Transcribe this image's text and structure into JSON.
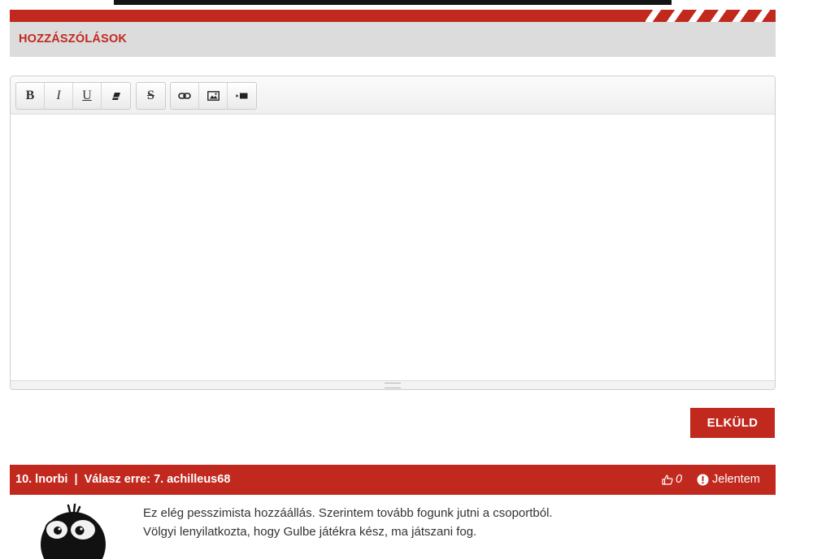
{
  "comments_section": {
    "title": "HOZZÁSZÓLÁSOK"
  },
  "editor": {
    "toolbar": {
      "groups": [
        [
          {
            "name": "bold",
            "icon": "bold-icon",
            "glyph": "B"
          },
          {
            "name": "italic",
            "icon": "italic-icon",
            "glyph": "I"
          },
          {
            "name": "underline",
            "icon": "underline-icon",
            "glyph": "U"
          },
          {
            "name": "remove-format",
            "icon": "eraser-icon"
          }
        ],
        [
          {
            "name": "strikethrough",
            "icon": "strikethrough-icon",
            "glyph": "S"
          }
        ],
        [
          {
            "name": "link",
            "icon": "link-icon"
          },
          {
            "name": "image",
            "icon": "image-icon"
          },
          {
            "name": "video",
            "icon": "video-icon"
          }
        ]
      ]
    },
    "content": ""
  },
  "submit": {
    "label": "ELKÜLD"
  },
  "comment": {
    "header": "10. lnorbi  |  Válasz erre: 7. achilleus68",
    "likes": "0",
    "report_label": "Jelentem",
    "lines": [
      "Ez elég pesszimista hozzáállás. Szerintem tovább fogunk jutni a csoportból.",
      "Völgyi lenyilatkozta, hogy Gulbe játékra kész, ma játszani fog."
    ]
  },
  "colors": {
    "brand_red": "#c1281e",
    "header_gray": "#dcdcdc",
    "text": "#333333"
  }
}
